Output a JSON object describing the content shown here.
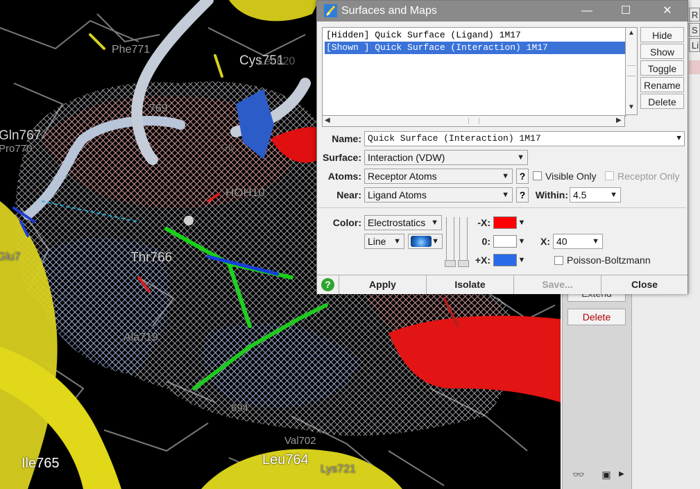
{
  "viewport": {
    "residue_labels": [
      "Phe771",
      "Cys751",
      "Leu820",
      "Gln767",
      "Pro770",
      "769",
      "Gly",
      "HOH10",
      "Thr766",
      "Ala719",
      "Glu7",
      "Ile765",
      "Leu764",
      "Lys721",
      "Val702",
      "694",
      "Leu694"
    ]
  },
  "dialog": {
    "title": "Surfaces and Maps",
    "window_controls": {
      "minimize": "—",
      "maximize": "☐",
      "close": "✕"
    },
    "surface_list": [
      "[Hidden] Quick Surface (Ligand) 1M17",
      "[Shown ] Quick Surface (Interaction) 1M17"
    ],
    "list_buttons": {
      "hide": "Hide",
      "show": "Show",
      "toggle": "Toggle",
      "rename": "Rename",
      "delete": "Delete"
    },
    "name": {
      "label": "Name:",
      "value": "Quick Surface (Interaction) 1M17"
    },
    "surface": {
      "label": "Surface:",
      "value": "Interaction (VDW)"
    },
    "atoms": {
      "label": "Atoms:",
      "value": "Receptor Atoms",
      "help": "?",
      "visible_only": "Visible Only",
      "receptor_only": "Receptor Only"
    },
    "near": {
      "label": "Near:",
      "value": "Ligand Atoms",
      "help": "?",
      "within_label": "Within:",
      "within_value": "4.5"
    },
    "color": {
      "label": "Color:",
      "value": "Electrostatics",
      "style": "Line",
      "neg_label": "-X:",
      "zero_label": "0:",
      "pos_label": "+X:",
      "neg_color": "#ff0000",
      "zero_color": "#ffffff",
      "pos_color": "#2a6ae8",
      "x_label": "X:",
      "x_value": "40",
      "poisson_boltzmann": "Poisson-Boltzmann"
    },
    "bottom_buttons": {
      "help": "?",
      "apply": "Apply",
      "isolate": "Isolate",
      "save": "Save...",
      "close": "Close"
    }
  },
  "side_panel": {
    "extend": "Extend",
    "delete": "Delete",
    "tabs": [
      "R",
      "S",
      "Li"
    ]
  }
}
